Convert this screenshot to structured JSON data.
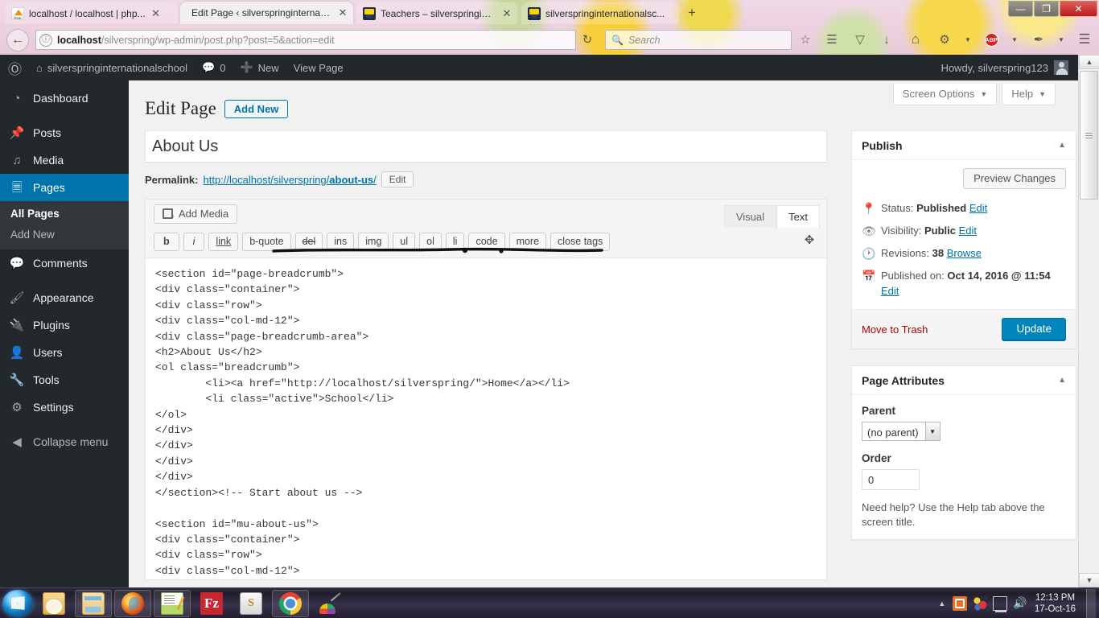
{
  "browser": {
    "tabs": [
      {
        "label": "localhost / localhost | php...",
        "favicon": "phpmyadmin-icon",
        "active": false,
        "close_label": "✕"
      },
      {
        "label": "Edit Page ‹ silverspringinternati...",
        "favicon": "wordpress-icon",
        "active": true,
        "close_label": "✕"
      },
      {
        "label": "Teachers – silverspringinter...",
        "favicon": "wordpress-icon",
        "active": false,
        "close_label": "✕"
      },
      {
        "label": "silverspringinternationalsc...",
        "favicon": "wordpress-icon",
        "active": false,
        "close_label": "✕"
      }
    ],
    "new_tab_label": "+",
    "window_controls": {
      "minimize": "—",
      "maximize": "❐",
      "close": "✕"
    },
    "back_label": "←",
    "identity_icon_label": "ⓘ",
    "url_host": "localhost",
    "url_path": "/silverspring/wp-admin/post.php?post=5&action=edit",
    "reload_label": "↻",
    "search_placeholder": "Search",
    "search_value": "",
    "toolbar_icons": [
      {
        "name": "bookmark-star-icon",
        "glyph": "☆"
      },
      {
        "name": "reading-list-icon",
        "glyph": "☰"
      },
      {
        "name": "pocket-icon",
        "glyph": "▽"
      },
      {
        "name": "downloads-icon",
        "glyph": "↓"
      },
      {
        "name": "home-icon",
        "glyph": "⌂"
      },
      {
        "name": "extension-icon",
        "glyph": "⚙"
      },
      {
        "name": "extension-caret-icon",
        "glyph": "▼"
      },
      {
        "name": "adblock-plus-icon",
        "glyph": "ABP"
      },
      {
        "name": "adblock-caret-icon",
        "glyph": "▼"
      },
      {
        "name": "eyedropper-icon",
        "glyph": "✒"
      },
      {
        "name": "eyedropper-caret-icon",
        "glyph": "▼"
      },
      {
        "name": "menu-hamburger-icon",
        "glyph": "☰"
      }
    ]
  },
  "adminbar": {
    "wp_logo": "wordpress-logo",
    "site_name": "silverspringinternationalschool",
    "comments_count": "0",
    "new_label": "New",
    "view_page_label": "View Page",
    "howdy": "Howdy, silverspring123"
  },
  "sidebar": {
    "items": [
      {
        "label": "Dashboard",
        "icon": "dashboard-icon",
        "glyph": "◔",
        "current": false
      },
      {
        "label": "Posts",
        "icon": "pin-icon",
        "glyph": "✒",
        "current": false
      },
      {
        "label": "Media",
        "icon": "media-icon",
        "glyph": "♫",
        "current": false
      },
      {
        "label": "Pages",
        "icon": "pages-icon",
        "glyph": "❐",
        "current": true
      },
      {
        "label": "Comments",
        "icon": "comment-icon",
        "glyph": "✉",
        "current": false
      },
      {
        "label": "Appearance",
        "icon": "appearance-brush-icon",
        "glyph": "⚒",
        "current": false
      },
      {
        "label": "Plugins",
        "icon": "plugins-plug-icon",
        "glyph": "⚡",
        "current": false
      },
      {
        "label": "Users",
        "icon": "users-icon",
        "glyph": "☺",
        "current": false
      },
      {
        "label": "Tools",
        "icon": "tools-wrench-icon",
        "glyph": "⚒",
        "current": false
      },
      {
        "label": "Settings",
        "icon": "settings-sliders-icon",
        "glyph": "⚙",
        "current": false
      }
    ],
    "submenu": [
      {
        "label": "All Pages",
        "current": true
      },
      {
        "label": "Add New",
        "current": false
      }
    ],
    "collapse_label": "Collapse menu",
    "collapse_icon": "collapse-arrow-icon"
  },
  "screen_meta": {
    "screen_options": "Screen Options",
    "help": "Help",
    "caret": "▼"
  },
  "page": {
    "title": "Edit Page",
    "add_new_label": "Add New",
    "post_title_value": "About Us",
    "post_title_placeholder": "Enter title here",
    "permalink_label": "Permalink:",
    "permalink_prefix": "http://localhost/silverspring/",
    "permalink_slug": "about-us",
    "permalink_suffix": "/",
    "permalink_edit_label": "Edit"
  },
  "editor": {
    "add_media_label": "Add Media",
    "add_media_icon": "add-media-icon",
    "tab_visual": "Visual",
    "tab_text": "Text",
    "active_tab": "Text",
    "fullscreen_icon": "fullscreen-icon",
    "quicktags": [
      "b",
      "i",
      "link",
      "b-quote",
      "del",
      "ins",
      "img",
      "ul",
      "ol",
      "li",
      "code",
      "more",
      "close tags"
    ],
    "content": "<section id=\"page-breadcrumb\">\n<div class=\"container\">\n<div class=\"row\">\n<div class=\"col-md-12\">\n<div class=\"page-breadcrumb-area\">\n<h2>About Us</h2>\n<ol class=\"breadcrumb\">\n        <li><a href=\"http://localhost/silverspring/\">Home</a></li>\n        <li class=\"active\">School</li>\n</ol>\n</div>\n</div>\n</div>\n</div>\n</section><!-- Start about us -->\n\n<section id=\"mu-about-us\">\n<div class=\"container\">\n<div class=\"row\">\n<div class=\"col-md-12\">"
  },
  "publish_box": {
    "title": "Publish",
    "toggle": "▲",
    "preview_label": "Preview Changes",
    "status_label": "Status:",
    "status_value": "Published",
    "status_edit": "Edit",
    "status_icon": "pin-marker-icon",
    "visibility_label": "Visibility:",
    "visibility_value": "Public",
    "visibility_edit": "Edit",
    "visibility_icon": "eye-icon",
    "revisions_label": "Revisions:",
    "revisions_value": "38",
    "revisions_browse": "Browse",
    "revisions_icon": "clock-icon",
    "published_label": "Published on:",
    "published_value": "Oct 14, 2016 @ 11:54",
    "published_edit": "Edit",
    "published_icon": "calendar-icon",
    "trash_label": "Move to Trash",
    "update_label": "Update",
    "accent_color": "#0085ba",
    "trash_color": "#a00"
  },
  "page_attributes": {
    "title": "Page Attributes",
    "toggle": "▲",
    "parent_label": "Parent",
    "parent_value": "(no parent)",
    "parent_caret": "▼",
    "order_label": "Order",
    "order_value": "0",
    "help_note": "Need help? Use the Help tab above the screen title."
  },
  "scrollbar": {
    "up": "▲",
    "down": "▼"
  },
  "taskbar": {
    "start_label": "Start",
    "apps": [
      {
        "name": "taskbar-mail-icon",
        "cls": "g-mail",
        "pinned": false
      },
      {
        "name": "taskbar-explorer-icon",
        "cls": "g-folder",
        "pinned": true
      },
      {
        "name": "taskbar-firefox-icon",
        "cls": "g-firefox",
        "pinned": true
      },
      {
        "name": "taskbar-notepadpp-icon",
        "cls": "g-notepad",
        "pinned": true
      },
      {
        "name": "taskbar-filezilla-icon",
        "cls": "g-fz",
        "pinned": false,
        "text": "Fz"
      },
      {
        "name": "taskbar-sublime-icon",
        "cls": "g-sub",
        "pinned": false,
        "text": "S"
      },
      {
        "name": "taskbar-chrome-icon",
        "cls": "g-chrome",
        "pinned": true
      },
      {
        "name": "taskbar-paint-icon",
        "cls": "g-paint",
        "pinned": false
      }
    ],
    "tray": [
      {
        "name": "tray-expand-arrow-icon",
        "cls": "t-arrow",
        "glyph": "▲"
      },
      {
        "name": "tray-xampp-icon",
        "cls": "t-orange",
        "glyph": ""
      },
      {
        "name": "tray-colorpicker-icon",
        "cls": "t-color",
        "glyph": ""
      },
      {
        "name": "tray-network-icon",
        "cls": "t-net",
        "glyph": ""
      },
      {
        "name": "tray-volume-icon",
        "cls": "t-vol",
        "glyph": "🔊"
      }
    ],
    "clock_time": "12:13 PM",
    "clock_date": "17-Oct-16"
  }
}
